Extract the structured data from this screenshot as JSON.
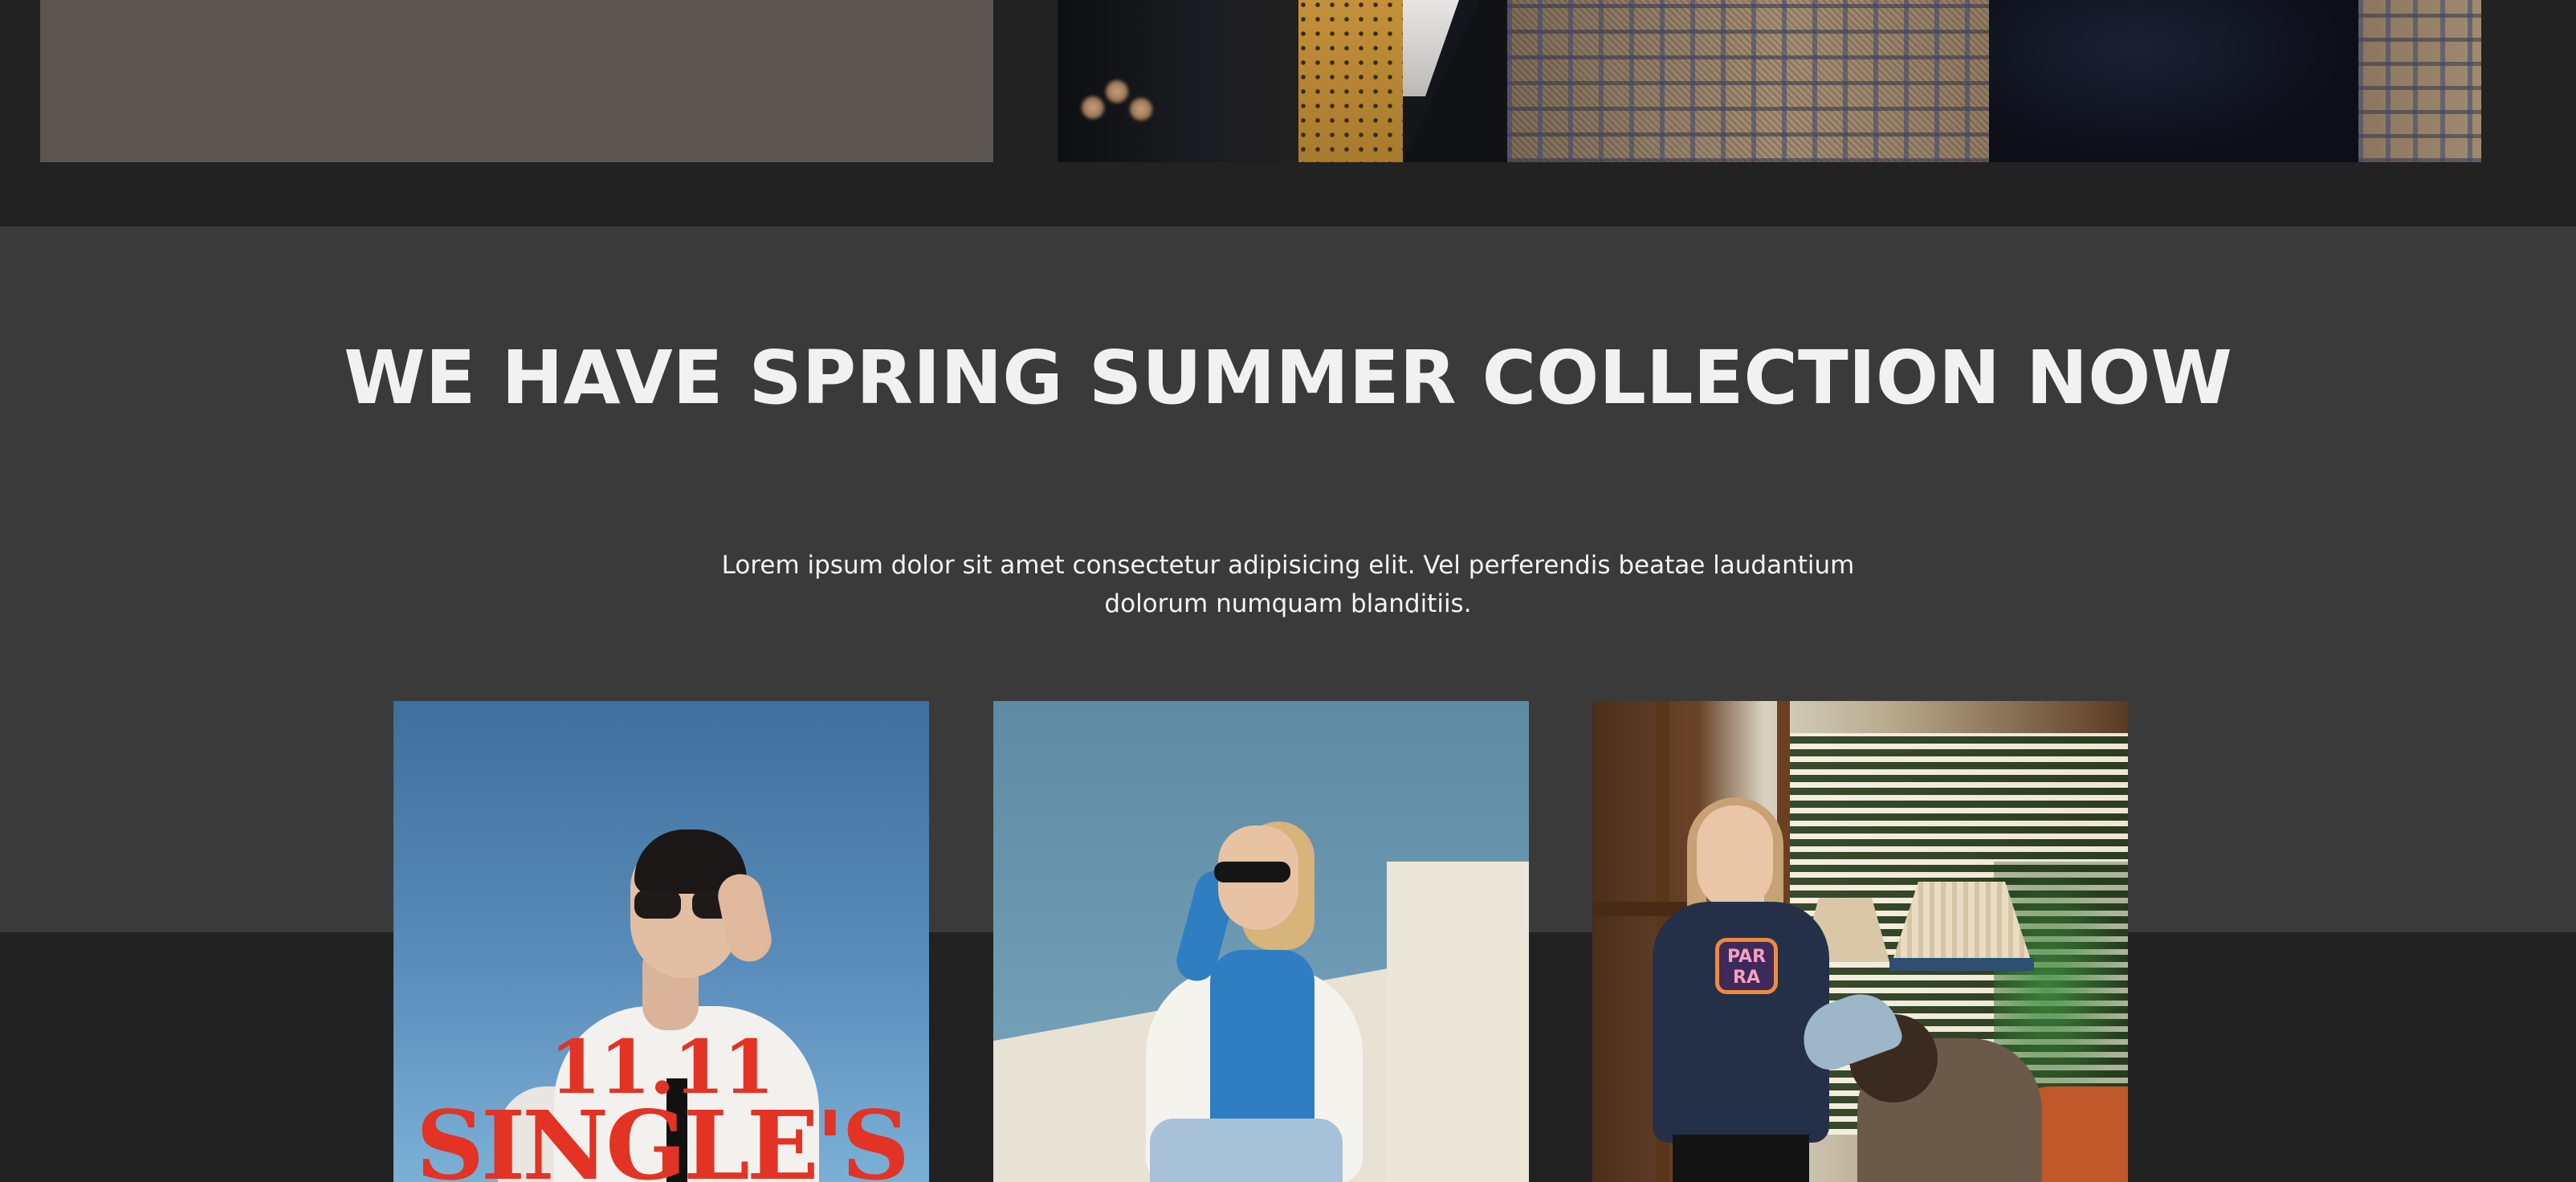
{
  "collection": {
    "title": "WE HAVE SPRING SUMMER COLLECTION NOW",
    "description": "Lorem ipsum dolor sit amet consectetur adipisicing elit. Vel perferendis beatae laudantium dolorum numquam blanditiis."
  },
  "products": [
    {
      "poster_date": "11.11",
      "poster_brand": "SINGLE'S"
    },
    {},
    {
      "sweater_logo": "PAR RA"
    }
  ],
  "colors": {
    "page_background": "#222222",
    "section_background": "#3a3a3a",
    "title_text": "#f1f1f1",
    "poster_red": "#e23325"
  }
}
